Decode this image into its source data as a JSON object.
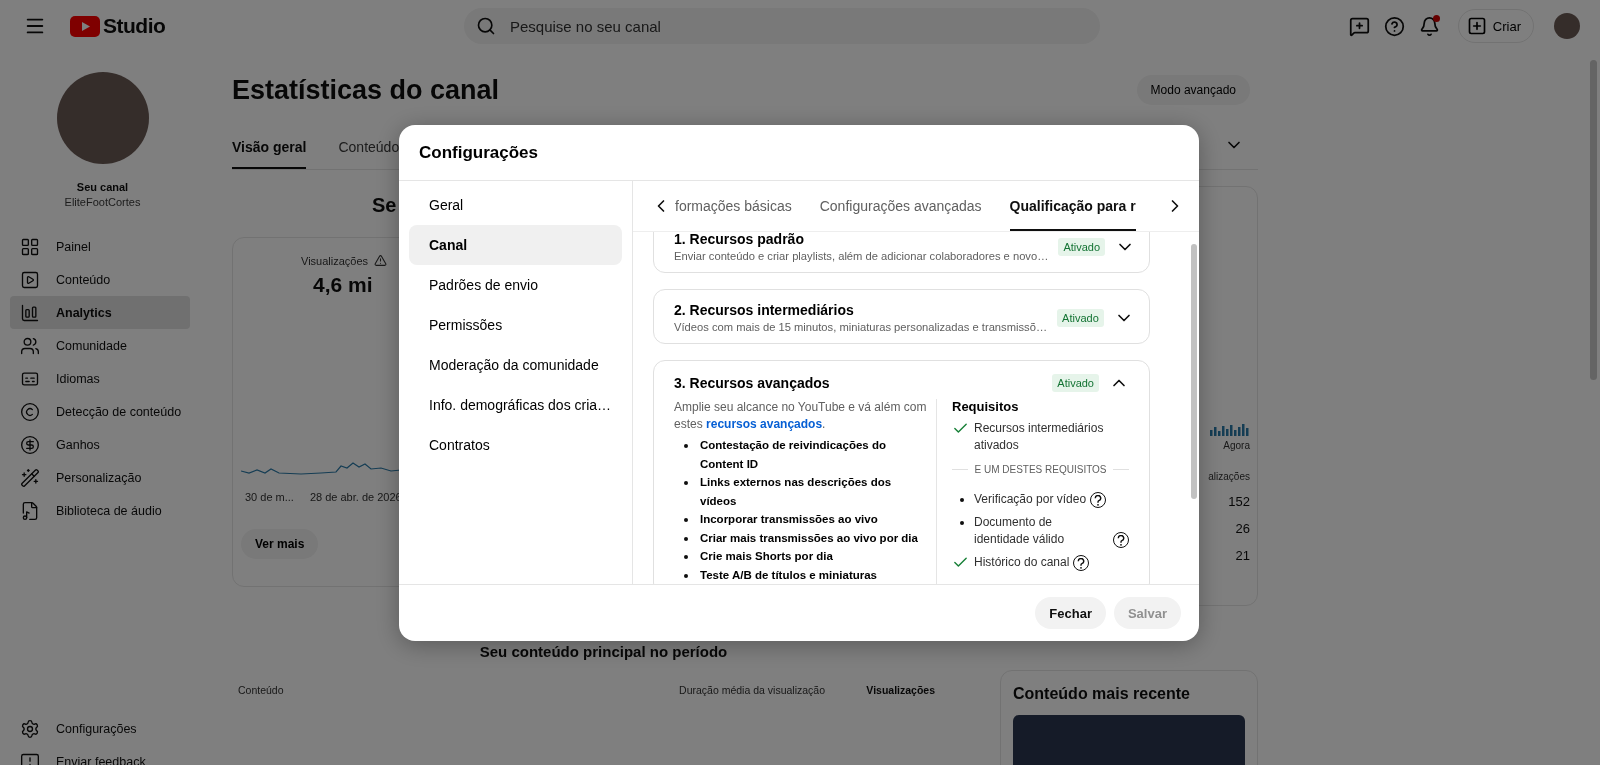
{
  "topbar": {
    "logo": "Studio",
    "search": {
      "placeholder": "Pesquise no seu canal"
    },
    "create": "Criar",
    "notification": true
  },
  "sidebar": {
    "channel_label": "Seu canal",
    "channel_name": "EliteFootCortes",
    "items": [
      {
        "label": "Painel",
        "selected": false
      },
      {
        "label": "Conteúdo",
        "selected": false
      },
      {
        "label": "Analytics",
        "selected": true
      },
      {
        "label": "Comunidade",
        "selected": false
      },
      {
        "label": "Idiomas",
        "selected": false
      },
      {
        "label": "Detecção de conteúdo",
        "selected": false
      },
      {
        "label": "Ganhos",
        "selected": false
      },
      {
        "label": "Personalização",
        "selected": false
      },
      {
        "label": "Biblioteca de áudio",
        "selected": false
      }
    ],
    "footer_items": [
      {
        "label": "Configurações"
      },
      {
        "label": "Enviar feedback"
      }
    ]
  },
  "page": {
    "title": "Estatísticas do canal",
    "advanced_mode": "Modo avançado",
    "tabs": [
      {
        "label": "Visão geral",
        "selected": true
      },
      {
        "label": "Conteúdo",
        "selected": false
      }
    ],
    "section_heading": "Se",
    "metric": {
      "label": "Visualizações",
      "value": "4,6 mi"
    },
    "axis_labels": [
      "30 de m...",
      "28 de abr. de 2026"
    ],
    "see_more": "Ver mais",
    "realtime": {
      "axis_label": "Agora",
      "column": "alizações",
      "values": [
        "152",
        "26",
        "21"
      ]
    },
    "top_content": {
      "heading": "Seu conteúdo principal no período",
      "columns": [
        "Conteúdo",
        "Duração média da visualização",
        "Visualizações"
      ]
    },
    "latest": {
      "heading": "Conteúdo mais recente"
    }
  },
  "dialog": {
    "title": "Configurações",
    "nav": [
      {
        "label": "Geral",
        "selected": false
      },
      {
        "label": "Canal",
        "selected": true
      },
      {
        "label": "Padrões de envio",
        "selected": false
      },
      {
        "label": "Permissões",
        "selected": false
      },
      {
        "label": "Moderação da comunidade",
        "selected": false
      },
      {
        "label": "Info. demográficas dos cria…",
        "selected": false
      },
      {
        "label": "Contratos",
        "selected": false
      }
    ],
    "tabs": [
      {
        "label": "formações básicas",
        "selected": false
      },
      {
        "label": "Configurações avançadas",
        "selected": false
      },
      {
        "label": "Qualificação para r",
        "selected": true
      }
    ],
    "sections": [
      {
        "title": "1. Recursos padrão",
        "description": "Enviar conteúdo e criar playlists, além de adicionar colaboradores e novo…",
        "status": "Ativado",
        "expanded": false
      },
      {
        "title": "2. Recursos intermediários",
        "description": "Vídeos com mais de 15 minutos, miniaturas personalizadas e transmissõ…",
        "status": "Ativado",
        "expanded": false
      },
      {
        "title": "3. Recursos avançados",
        "status": "Ativado",
        "expanded": true,
        "intro": "Amplie seu alcance no YouTube e vá além com estes",
        "intro_link": "recursos avançados",
        "intro_end": ".",
        "features": [
          "Contestação de reivindicações do Content ID",
          "Links externos nas descrições dos vídeos",
          "Incorporar transmissões ao vivo",
          "Criar mais transmissões ao vivo por dia",
          "Crie mais Shorts por dia",
          "Teste A/B de títulos e miniaturas"
        ],
        "requirements_heading": "Requisitos",
        "requirements": [
          {
            "label": "Recursos intermediários ativados",
            "met": true,
            "help": false
          }
        ],
        "separator": "E UM DESTES REQUISITOS",
        "options": [
          {
            "label": "Verificação por vídeo",
            "met": false,
            "help": true
          },
          {
            "label": "Documento de identidade válido",
            "met": false,
            "help": true
          },
          {
            "label": "Histórico do canal",
            "met": true,
            "help": true
          }
        ]
      }
    ],
    "buttons": [
      {
        "label": "Fechar",
        "disabled": false
      },
      {
        "label": "Salvar",
        "disabled": true
      }
    ]
  }
}
